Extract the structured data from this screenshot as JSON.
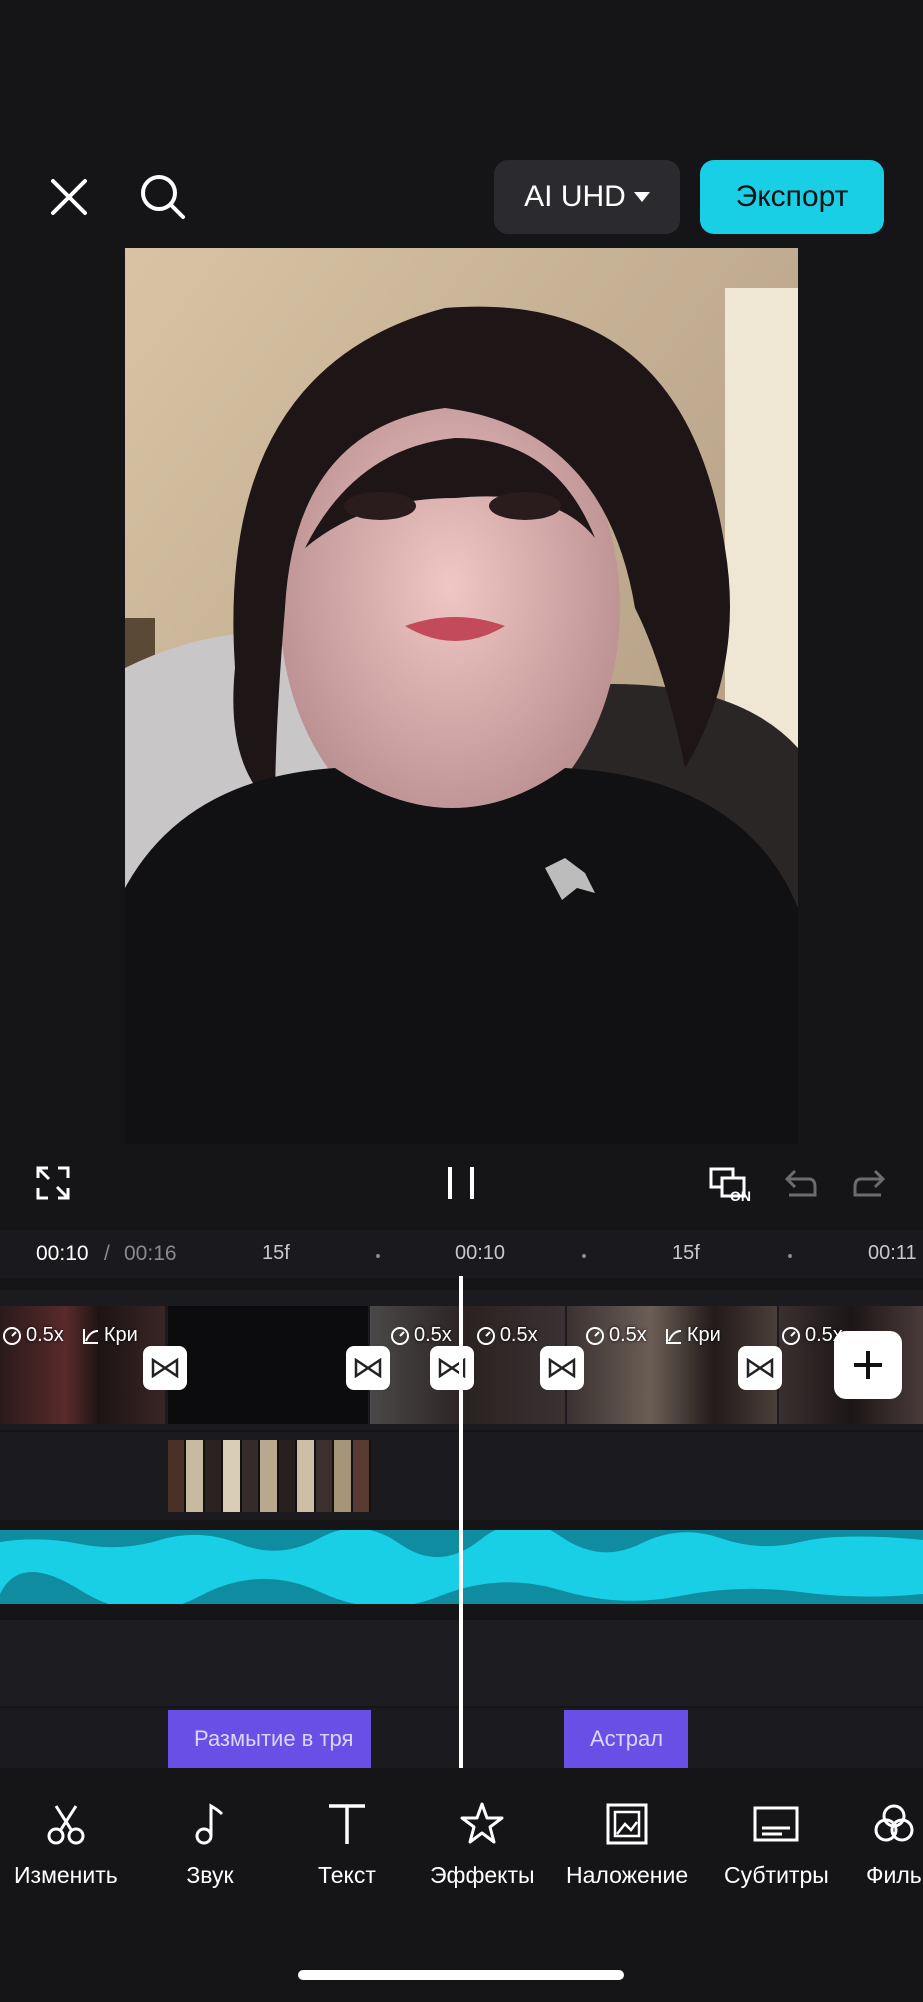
{
  "top_bar": {
    "close_icon": "close-icon",
    "search_icon": "search-icon",
    "quality_label": "AI UHD",
    "export_label": "Экспорт"
  },
  "colors": {
    "accent": "#19cfe6",
    "effect_chip": "#6a4fe6",
    "audio_track": "#19cfe6"
  },
  "controls": {
    "fullscreen_icon": "fullscreen-icon",
    "pause_icon": "pause-icon",
    "keyframe_label": "ON",
    "undo_icon": "undo-icon",
    "redo_icon": "redo-icon"
  },
  "timeline": {
    "current_time": "00:10",
    "separator": "/",
    "total_time": "00:16",
    "ruler_labels": [
      "15f",
      "00:10",
      "15f",
      "00:11"
    ]
  },
  "clips": [
    {
      "speed": "0.5x",
      "curve": "Кри"
    },
    {
      "speed": "0.5x",
      "curve": ""
    },
    {
      "speed": "0.5x",
      "curve": ""
    },
    {
      "speed": "0.5x",
      "curve": "Кри"
    },
    {
      "speed": "0.5x",
      "curve": ""
    }
  ],
  "effects": [
    {
      "label": "Размытие в тря"
    },
    {
      "label": "Астрал"
    }
  ],
  "toolbar": {
    "items": [
      {
        "label": "Изменить",
        "icon": "scissors-icon"
      },
      {
        "label": "Звук",
        "icon": "music-note-icon"
      },
      {
        "label": "Текст",
        "icon": "text-icon"
      },
      {
        "label": "Эффекты",
        "icon": "star-icon"
      },
      {
        "label": "Наложение",
        "icon": "overlay-icon"
      },
      {
        "label": "Субтитры",
        "icon": "subtitles-icon"
      },
      {
        "label": "Филь",
        "icon": "filter-icon"
      }
    ]
  }
}
